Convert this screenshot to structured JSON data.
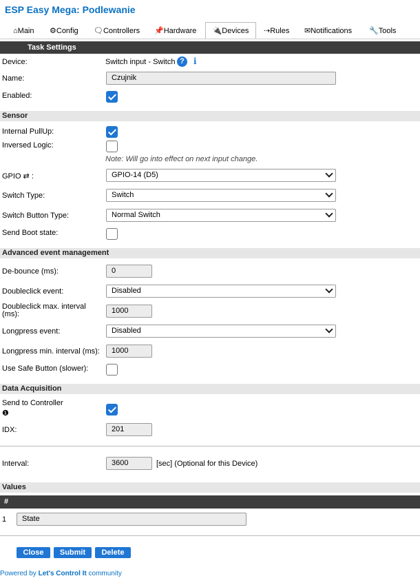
{
  "app": {
    "title": "ESP Easy Mega: Podlewanie"
  },
  "tabs": [
    {
      "label": "Main",
      "icon": "home-icon",
      "glyph": "⌂"
    },
    {
      "label": "Config",
      "icon": "gear-icon",
      "glyph": "⚙"
    },
    {
      "label": "Controllers",
      "icon": "chat-icon",
      "glyph": "🗨"
    },
    {
      "label": "Hardware",
      "icon": "pin-icon",
      "glyph": "📌"
    },
    {
      "label": "Devices",
      "icon": "plug-icon",
      "glyph": "🔌"
    },
    {
      "label": "Rules",
      "icon": "arrow-right-icon",
      "glyph": "⇢"
    },
    {
      "label": "Notifications",
      "icon": "mail-icon",
      "glyph": "✉"
    },
    {
      "label": "Tools",
      "icon": "wrench-icon",
      "glyph": "🔧"
    }
  ],
  "active_tab": "Devices",
  "task_settings": {
    "header": "Task Settings",
    "device_label": "Device:",
    "device_value": "Switch input - Switch",
    "help_glyph": "?",
    "info_glyph": "i",
    "name_label": "Name:",
    "name_value": "Czujnik",
    "enabled_label": "Enabled:",
    "enabled": true
  },
  "sensor": {
    "header": "Sensor",
    "pullup_label": "Internal PullUp:",
    "pullup": true,
    "inversed_label": "Inversed Logic:",
    "inversed": false,
    "note": "Note: Will go into effect on next input change.",
    "gpio_label": "GPIO ⇄ :",
    "gpio_value": "GPIO-14 (D5)",
    "switch_type_label": "Switch Type:",
    "switch_type_value": "Switch",
    "button_type_label": "Switch Button Type:",
    "button_type_value": "Normal Switch",
    "boot_label": "Send Boot state:",
    "boot": false
  },
  "advanced": {
    "header": "Advanced event management",
    "debounce_label": "De-bounce (ms):",
    "debounce_value": "0",
    "dblclick_label": "Doubleclick event:",
    "dblclick_value": "Disabled",
    "dblclick_interval_label_1": "Doubleclick max. interval",
    "dblclick_interval_label_2": "(ms):",
    "dblclick_interval_value": "1000",
    "longpress_label": "Longpress event:",
    "longpress_value": "Disabled",
    "longpress_interval_label": "Longpress min. interval (ms):",
    "longpress_interval_value": "1000",
    "safe_button_label": "Use Safe Button (slower):",
    "safe_button": false
  },
  "data_acq": {
    "header": "Data Acquisition",
    "send_label": "Send to Controller",
    "send_index": "❶",
    "send": true,
    "idx_label": "IDX:",
    "idx_value": "201",
    "interval_label": "Interval:",
    "interval_value": "3600",
    "interval_suffix": "[sec] (Optional for this Device)"
  },
  "values": {
    "header": "Values",
    "col_hash": "#",
    "rows": [
      {
        "num": "1",
        "name": "State"
      }
    ]
  },
  "buttons": {
    "close": "Close",
    "submit": "Submit",
    "delete": "Delete"
  },
  "footer": {
    "prefix": "Powered by ",
    "link": "Let's Control It",
    "suffix": " community"
  }
}
